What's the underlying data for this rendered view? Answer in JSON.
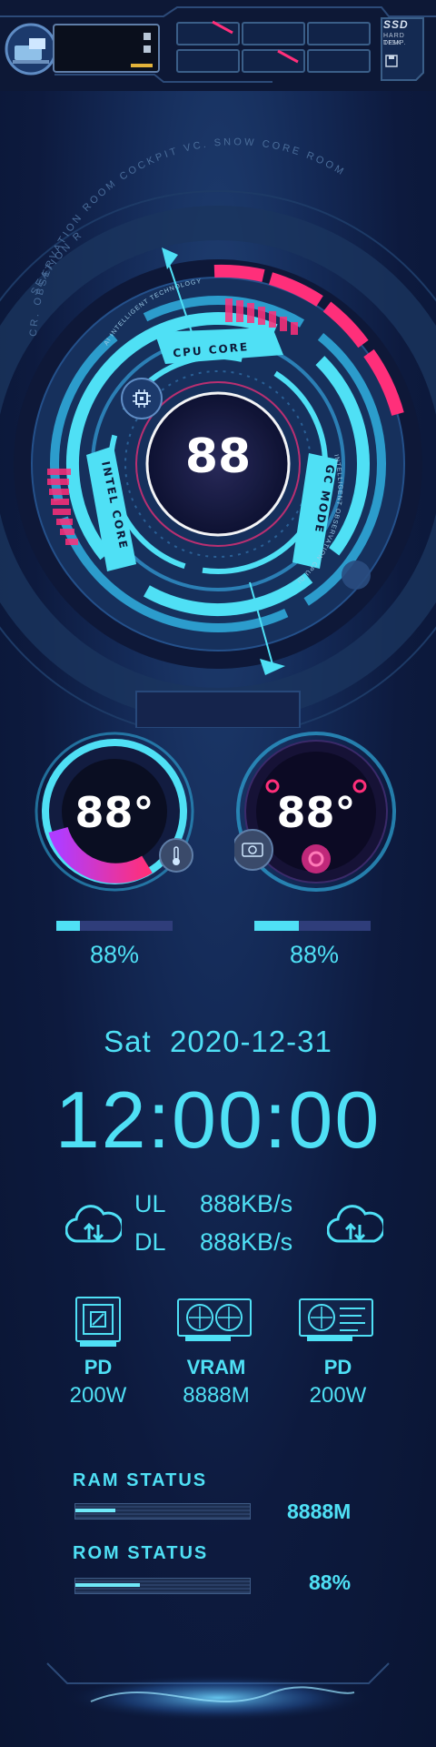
{
  "ssd_badge": {
    "title": "SSD",
    "subtitle_line1": "HARD DISK",
    "subtitle_line2": "TEMP."
  },
  "cpu_dial": {
    "ring_text": "CR. OBSERVATION ROOM COCKPIT VC. SNOW CORE ROOM",
    "ring_text_left": "SEATION ROOM",
    "inner_tag_top": "CPU CORE",
    "inner_tag_left": "INTEL CORE",
    "inner_tag_right": "GC MODE",
    "small_text_top": "AI INTELLIGENT TECHNOLOGY",
    "small_text_right": "INTELLIGENT OBSERVATION CPU DISPLAY",
    "value": "88"
  },
  "gauges": [
    {
      "name": "cpu-temp",
      "value": "88°",
      "percent_label": "88%",
      "percent": 0.2
    },
    {
      "name": "gpu-temp",
      "value": "88°",
      "percent_label": "88%",
      "percent": 0.38
    }
  ],
  "datetime": {
    "day": "Sat",
    "date": "2020-12-31",
    "time": "12:00:00"
  },
  "network": {
    "ul_label": "UL",
    "ul_value": "888KB/s",
    "dl_label": "DL",
    "dl_value": "888KB/s"
  },
  "hardware": [
    {
      "label": "PD",
      "value": "200W",
      "icon": "cpu-chip-icon"
    },
    {
      "label": "VRAM",
      "value": "8888M",
      "icon": "graphics-card-icon"
    },
    {
      "label": "PD",
      "value": "200W",
      "icon": "gpu-board-icon"
    }
  ],
  "ram": {
    "label": "RAM STATUS",
    "value": "8888M",
    "fill": 0.23
  },
  "rom": {
    "label": "ROM STATUS",
    "value": "88%",
    "fill": 0.37
  },
  "colors": {
    "accent": "#4fe0f5",
    "pink": "#ff2f7a",
    "bg": "#0e1a3a"
  }
}
